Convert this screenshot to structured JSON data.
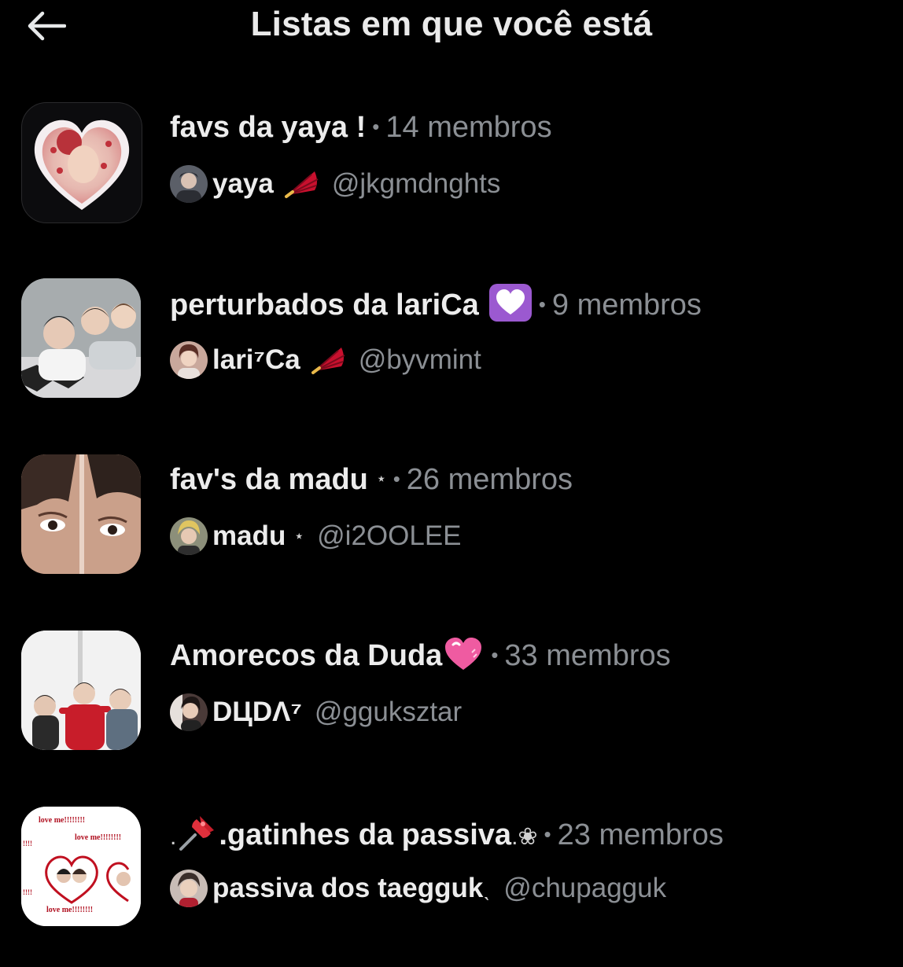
{
  "header": {
    "back_label": "back",
    "title": "Listas em que você está"
  },
  "separator": "•",
  "lists": [
    {
      "name": "favs da yaya !",
      "members": "14 membros",
      "owner_name": "yaya",
      "owner_handle": "@jkgmdnghts",
      "owner_emoji": "folding-fan-icon"
    },
    {
      "name": "perturbados da lariCa",
      "name_emoji": "white-heart-emoji",
      "members": "9 membros",
      "owner_name": "lari⁷Ca",
      "owner_handle": "@byvmint",
      "owner_emoji": "folding-fan-icon"
    },
    {
      "name": "fav's da madu",
      "name_suffix": "⋆",
      "members": "26 membros",
      "owner_name": "madu",
      "owner_suffix": "⋆",
      "owner_handle": "@i2OOLEE"
    },
    {
      "name": "Amorecos da Duda",
      "name_emoji": "pink-heart-emoji",
      "members": "33 membros",
      "owner_name": "DЦDΛ⁷",
      "owner_handle": "@gguksztar"
    },
    {
      "name_prefix": ".",
      "name_emoji": "pushpin-emoji",
      "name": ".gatinhes da passiva",
      "name_suffix": ".❀",
      "members": "23 membros",
      "owner_name": "passiva dos taegguk",
      "owner_suffix": "ˎ",
      "owner_handle": "@chupagguk"
    }
  ],
  "thumb5_text": {
    "line": "love me!!!!!!!!",
    "marks": "!!!!"
  },
  "colors": {
    "background": "#000000",
    "primary_text": "#e7e9ea",
    "secondary_text": "#8b8f94",
    "fan_red": "#c8102e",
    "white_heart_bg": "#9b59d0",
    "pink_heart": "#ef5ba1"
  }
}
